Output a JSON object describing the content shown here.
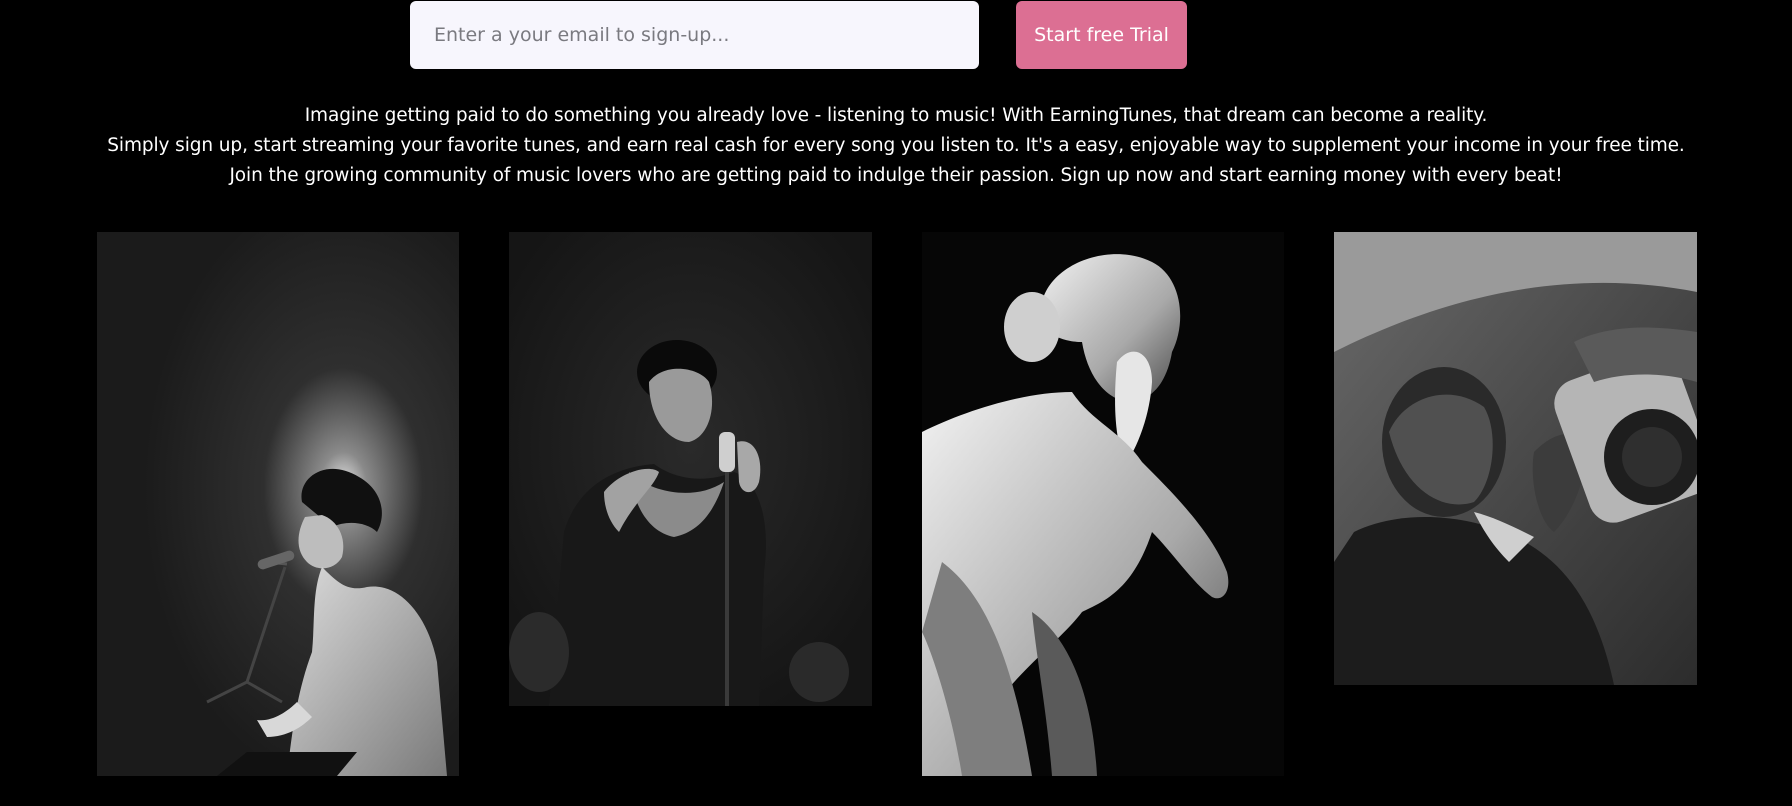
{
  "signup": {
    "email_placeholder": "Enter a your email to sign-up...",
    "email_value": "",
    "trial_button_label": "Start free Trial"
  },
  "intro": {
    "lines": [
      "Imagine getting paid to do something you already love - listening to music! With EarningTunes, that dream can become a reality.",
      "Simply sign up, start streaming your favorite tunes, and earn real cash for every song you listen to. It's a easy, enjoyable way to supplement your income in your free time.",
      "Join the growing community of music lovers who are getting paid to indulge their passion. Sign up now and start earning money with every beat!"
    ]
  },
  "gallery": {
    "photos": [
      {
        "subject": "singer-with-microphone"
      },
      {
        "subject": "jazz-singer-at-vintage-microphone"
      },
      {
        "subject": "marble-statue-listening"
      },
      {
        "subject": "man-listening-to-boombox"
      }
    ]
  },
  "colors": {
    "background": "#000000",
    "accent": "#dc6f93",
    "input_background": "#f7f6fd",
    "text": "#ffffff"
  }
}
